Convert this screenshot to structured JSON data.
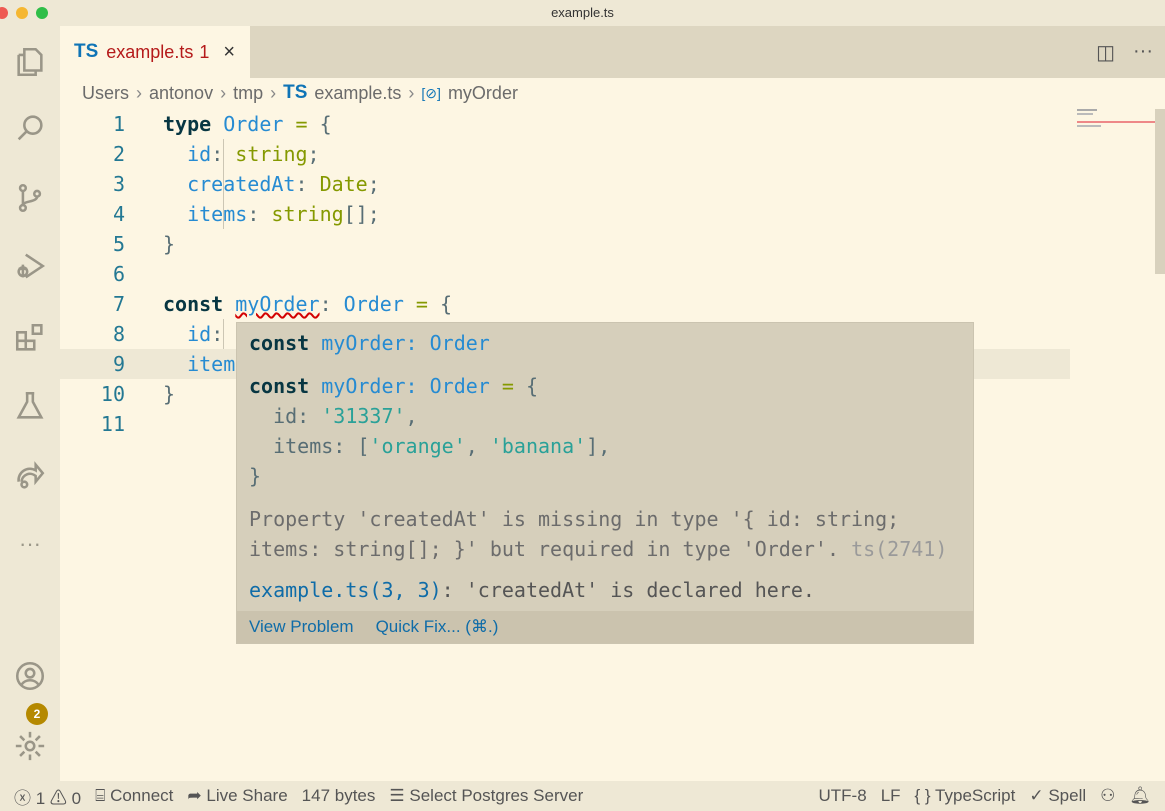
{
  "window": {
    "title": "example.ts"
  },
  "tab": {
    "lang": "TS",
    "name": "example.ts",
    "problems": "1",
    "close": "×"
  },
  "tab_actions": {
    "split": "◫",
    "more": "···"
  },
  "breadcrumb": [
    "Users",
    "antonov",
    "tmp",
    "example.ts",
    "myOrder"
  ],
  "breadcrumb_lang": "TS",
  "code": [
    [
      [
        "kw",
        "type"
      ],
      [
        "pu",
        " "
      ],
      [
        "ty",
        "Order"
      ],
      [
        "pu",
        " "
      ],
      [
        "op",
        "="
      ],
      [
        "pu",
        " {"
      ]
    ],
    [
      [
        "pu",
        "  "
      ],
      [
        "pr",
        "id"
      ],
      [
        "pu",
        ": "
      ],
      [
        "bt",
        "string"
      ],
      [
        "pu",
        ";"
      ]
    ],
    [
      [
        "pu",
        "  "
      ],
      [
        "pr",
        "createdAt"
      ],
      [
        "pu",
        ": "
      ],
      [
        "bt",
        "Date"
      ],
      [
        "pu",
        ";"
      ]
    ],
    [
      [
        "pu",
        "  "
      ],
      [
        "pr",
        "items"
      ],
      [
        "pu",
        ": "
      ],
      [
        "bt",
        "string"
      ],
      [
        "pu",
        "[];"
      ]
    ],
    [
      [
        "pu",
        "}"
      ]
    ],
    [],
    [
      [
        "kw",
        "const"
      ],
      [
        "pu",
        " "
      ],
      [
        "vr",
        "myOrder"
      ],
      [
        "pu",
        ": "
      ],
      [
        "ty",
        "Order"
      ],
      [
        "pu",
        " "
      ],
      [
        "op",
        "="
      ],
      [
        "pu",
        " {"
      ]
    ],
    [
      [
        "pu",
        "  "
      ],
      [
        "pr",
        "id"
      ],
      [
        "pu",
        ":"
      ]
    ],
    [
      [
        "pu",
        "  "
      ],
      [
        "pr",
        "item"
      ]
    ],
    [
      [
        "pu",
        "}"
      ]
    ],
    []
  ],
  "hover": {
    "lines": [
      [
        [
          "kw",
          "const"
        ],
        [
          "pu",
          " "
        ],
        [
          "ty",
          "myOrder: Order"
        ]
      ],
      [
        [
          "kw",
          "const"
        ],
        [
          "pu",
          " "
        ],
        [
          "ty",
          "myOrder: Order"
        ],
        [
          "op",
          " ="
        ],
        [
          "pu",
          " {"
        ]
      ],
      [
        [
          "pu",
          "  id: "
        ],
        [
          "st",
          "'31337'"
        ],
        [
          "pu",
          ","
        ]
      ],
      [
        [
          "pu",
          "  items: ["
        ],
        [
          "st",
          "'orange'"
        ],
        [
          "pu",
          ", "
        ],
        [
          "st",
          "'banana'"
        ],
        [
          "pu",
          "],"
        ]
      ],
      [
        [
          "pu",
          "}"
        ]
      ]
    ],
    "message_1": "Property 'createdAt' is missing in type '{ id: string;",
    "message_2": "items: string[]; }' but required in type 'Order'.",
    "code": "ts(2741)",
    "related_link": "example.ts(3, 3)",
    "related_text": ": 'createdAt' is declared here.",
    "actions": [
      "View Problem",
      "Quick Fix... (⌘.)"
    ]
  },
  "status": {
    "errors": "1",
    "warnings": "0",
    "connect": "Connect",
    "live_share": "Live Share",
    "size": "147 bytes",
    "postgres": "Select Postgres Server",
    "encoding": "UTF-8",
    "eol": "LF",
    "language": "TypeScript",
    "spell": "Spell"
  },
  "accounts_badge": "2",
  "colors": {
    "editor_bg": "#fdf6e3",
    "sidebar_bg": "#eee8d5",
    "keyword": "#073642",
    "type": "#268bd2",
    "builtin": "#859900",
    "string": "#2aa198",
    "error": "#d30102",
    "badge": "#b58900"
  }
}
